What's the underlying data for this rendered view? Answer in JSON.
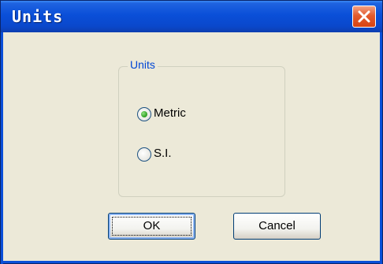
{
  "window": {
    "title": "Units",
    "close_label": "Close"
  },
  "group": {
    "legend": "Units"
  },
  "options": [
    {
      "label": "Metric",
      "selected": true
    },
    {
      "label": "S.I.",
      "selected": false
    }
  ],
  "buttons": {
    "ok": "OK",
    "cancel": "Cancel"
  },
  "colors": {
    "titlebar": "#0a4fd8",
    "legend": "#0046d5",
    "close": "#e35b2e",
    "background": "#ece9d8"
  }
}
